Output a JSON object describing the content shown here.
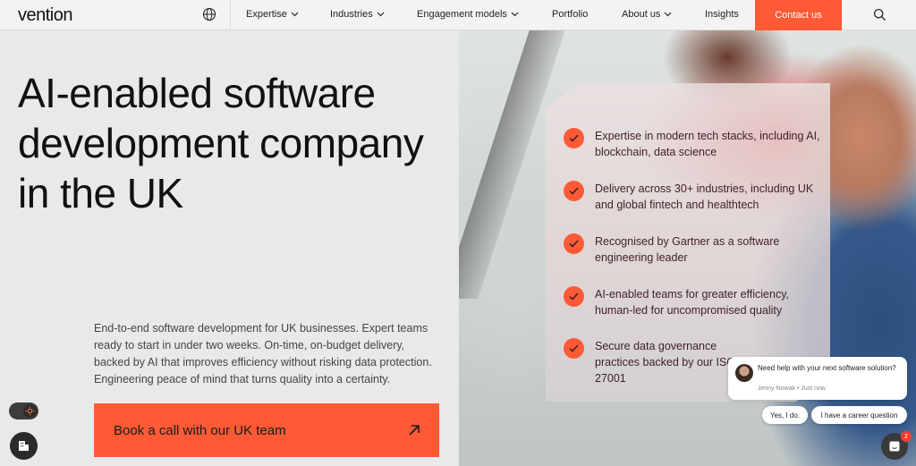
{
  "header": {
    "logo": "vention",
    "nav": [
      {
        "label": "Expertise",
        "has_dropdown": true
      },
      {
        "label": "Industries",
        "has_dropdown": true
      },
      {
        "label": "Engagement models",
        "has_dropdown": true
      },
      {
        "label": "Portfolio",
        "has_dropdown": false
      },
      {
        "label": "About us",
        "has_dropdown": true
      },
      {
        "label": "Insights",
        "has_dropdown": false
      }
    ],
    "contact_label": "Contact us",
    "icons": {
      "language": "globe-icon",
      "search": "search-icon"
    }
  },
  "hero": {
    "title": "AI-enabled software development company in the UK",
    "description": "End-to-end software development for UK businesses. Expert teams ready to start in under two weeks. On-time, on-budget delivery, backed by AI that improves efficiency without risking data protection. Engineering peace of mind that turns quality into a certainty.",
    "cta_label": "Book a call with our UK team"
  },
  "features": [
    "Expertise in modern tech stacks, including AI, blockchain, data science",
    "Delivery across 30+ industries, including UK and global fintech and healthtech",
    "Recognised by Gartner as a software engineering leader",
    "AI-enabled teams for greater efficiency, human-led for uncompromised quality",
    "Secure data governance practices backed by our ISO 27001"
  ],
  "chat": {
    "message": "Need help with your next software solution?",
    "meta": "Jenny Nowak • Just now",
    "reply_yes": "Yes, I do.",
    "reply_career": "I have a career question",
    "badge_count": "2"
  },
  "colors": {
    "accent": "#ff5a36",
    "background": "#e9e9ea",
    "feature_text": "#3d1f2a"
  }
}
